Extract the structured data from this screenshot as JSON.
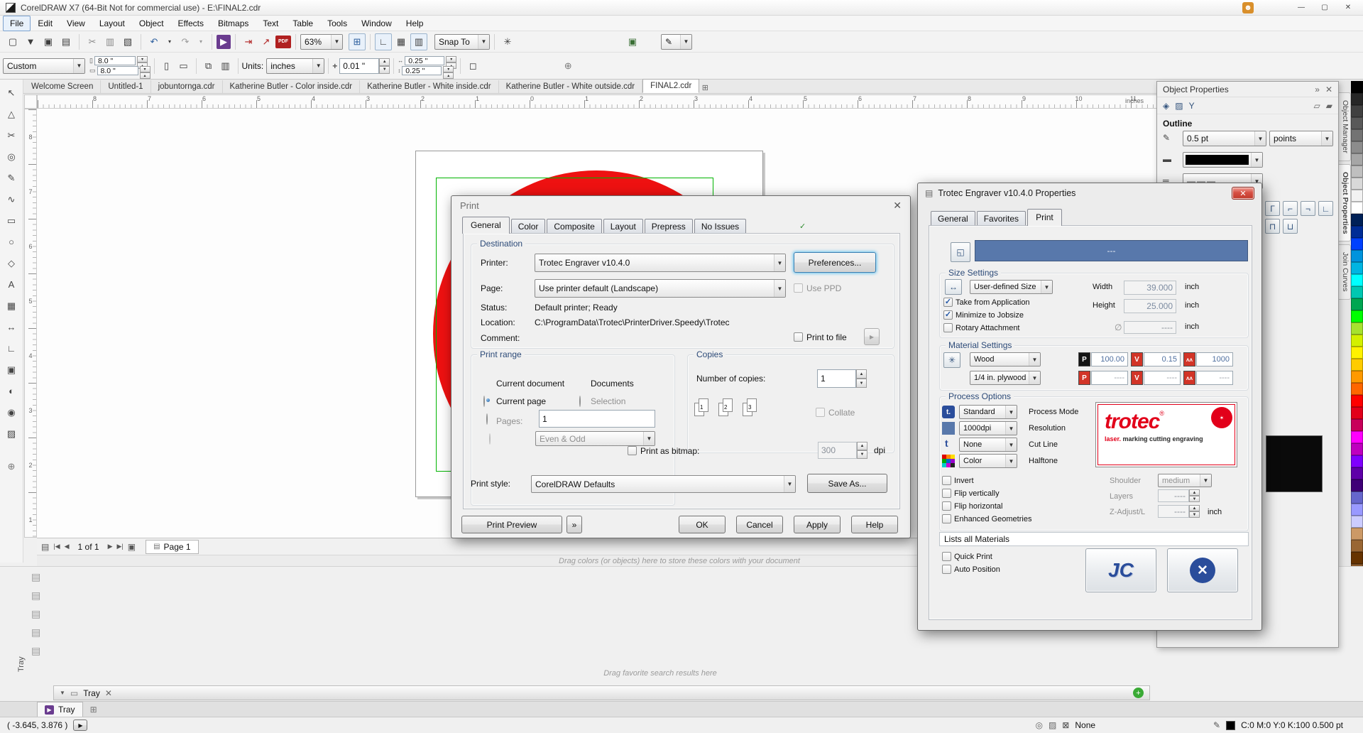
{
  "win": {
    "title": "CorelDRAW X7 (64-Bit Not for commercial use) - E:\\FINAL2.cdr"
  },
  "menu": [
    {
      "label": "File",
      "focus": true
    },
    {
      "label": "Edit"
    },
    {
      "label": "View"
    },
    {
      "label": "Layout"
    },
    {
      "label": "Object"
    },
    {
      "label": "Effects"
    },
    {
      "label": "Bitmaps"
    },
    {
      "label": "Text"
    },
    {
      "label": "Table"
    },
    {
      "label": "Tools"
    },
    {
      "label": "Window"
    },
    {
      "label": "Help"
    }
  ],
  "tb": {
    "zoom": "63%",
    "snap": "Snap To"
  },
  "pb": {
    "preset": "Custom",
    "w": "8.0 \"",
    "h": "8.0 \"",
    "units_l": "Units:",
    "units": "inches",
    "nudge": "0.01 \"",
    "dx": "0.25 \"",
    "dy": "0.25 \""
  },
  "tabs": [
    {
      "label": "Welcome Screen"
    },
    {
      "label": "Untitled-1"
    },
    {
      "label": "jobuntornga.cdr"
    },
    {
      "label": "Katherine Butler - Color inside.cdr"
    },
    {
      "label": "Katherine Butler - White inside.cdr"
    },
    {
      "label": "Katherine Butler - White outside.cdr"
    },
    {
      "label": "FINAL2.cdr",
      "active": true
    }
  ],
  "rul": {
    "h": [
      "8",
      "7",
      "6",
      "5",
      "4",
      "3",
      "2",
      "1",
      "0",
      "1",
      "2",
      "3",
      "4",
      "5",
      "6",
      "7",
      "8",
      "9",
      "10",
      "11"
    ],
    "v": [
      "8",
      "7",
      "6",
      "5",
      "4",
      "3",
      "2",
      "1"
    ],
    "unit": "inches"
  },
  "tools": [
    {
      "name": "pick-tool-icon",
      "g": "↖"
    },
    {
      "name": "shape-tool-icon",
      "g": "△"
    },
    {
      "name": "crop-tool-icon",
      "g": "✂"
    },
    {
      "name": "zoom-tool-icon",
      "g": "◎"
    },
    {
      "name": "freehand-tool-icon",
      "g": "✎"
    },
    {
      "name": "artistic-media-tool-icon",
      "g": "∿"
    },
    {
      "name": "rectangle-tool-icon",
      "g": "▭"
    },
    {
      "name": "ellipse-tool-icon",
      "g": "○"
    },
    {
      "name": "polygon-tool-icon",
      "g": "◇"
    },
    {
      "name": "text-tool-icon",
      "g": "A"
    },
    {
      "name": "table-tool-icon",
      "g": "▦"
    },
    {
      "name": "dimension-tool-icon",
      "g": "↔"
    },
    {
      "name": "connector-tool-icon",
      "g": "∟"
    },
    {
      "name": "drop-shadow-tool-icon",
      "g": "▣"
    },
    {
      "name": "transparency-tool-icon",
      "g": "◐"
    },
    {
      "name": "eyedropper-tool-icon",
      "g": "◉"
    },
    {
      "name": "interactive-fill-tool-icon",
      "g": "▨"
    }
  ],
  "pd": {
    "title": "Print",
    "tabs": [
      {
        "l": "General",
        "active": true
      },
      {
        "l": "Color"
      },
      {
        "l": "Composite"
      },
      {
        "l": "Layout"
      },
      {
        "l": "Prepress"
      },
      {
        "l": "No Issues",
        "icon": true
      }
    ],
    "dest": {
      "leg": "Destination",
      "printer_l": "Printer:",
      "printer": "Trotec Engraver v10.4.0",
      "prefs": "Preferences...",
      "page_l": "Page:",
      "page": "Use printer default (Landscape)",
      "ppd": "Use PPD",
      "status_l": "Status:",
      "status": "Default printer; Ready",
      "loc_l": "Location:",
      "loc": "C:\\ProgramData\\Trotec\\PrinterDriver.Speedy\\Trotec",
      "com_l": "Comment:",
      "ptf": "Print to file"
    },
    "rng": {
      "leg": "Print range",
      "cd": "Current document",
      "docs": "Documents",
      "cp": "Current page",
      "sel": "Selection",
      "pages_l": "Pages:",
      "pages": "1",
      "eo": "Even & Odd"
    },
    "cop": {
      "leg": "Copies",
      "n_l": "Number of copies:",
      "n": "1",
      "collate": "Collate",
      "pgs": [
        "1",
        "2",
        "3"
      ]
    },
    "bmp": {
      "l": "Print as bitmap:",
      "v": "300",
      "u": "dpi"
    },
    "sty": {
      "l": "Print style:",
      "v": "CorelDRAW Defaults",
      "save": "Save As..."
    },
    "btn": {
      "prev": "Print Preview",
      "ok": "OK",
      "cancel": "Cancel",
      "apply": "Apply",
      "help": "Help"
    }
  },
  "td": {
    "title": "Trotec Engraver v10.4.0 Properties",
    "tabs": [
      {
        "l": "General"
      },
      {
        "l": "Favorites"
      },
      {
        "l": "Print",
        "active": true
      }
    ],
    "bar": "---",
    "size": {
      "leg": "Size Settings",
      "preset": "User-defined Size",
      "w_l": "Width",
      "w": "39.000",
      "h_l": "Height",
      "h": "25.000",
      "u": "inch",
      "c1": "Take from Application",
      "c2": "Minimize to Jobsize",
      "c3": "Rotary Attachment",
      "dia": "∅",
      "dia_v": "----"
    },
    "mat": {
      "leg": "Material Settings",
      "grp": "Wood",
      "typ": "1/4 in. plywood",
      "p": "P",
      "v": "V",
      "p1": "100.00",
      "v1": "0.15",
      "f1": "1000",
      "p2": "----",
      "v2": "----",
      "f2": "----"
    },
    "proc": {
      "leg": "Process Options",
      "mode": "Standard",
      "mode_l": "Process Mode",
      "res": "1000dpi",
      "res_l": "Resolution",
      "cut": "None",
      "cut_l": "Cut Line",
      "half": "Color",
      "half_l": "Halftone",
      "c1": "Invert",
      "c2": "Flip vertically",
      "c3": "Flip horizontal",
      "c4": "Enhanced Geometries",
      "sh_l": "Shoulder",
      "sh": "medium",
      "lay_l": "Layers",
      "lay": "----",
      "z_l": "Z-Adjust/L",
      "z": "----",
      "z_u": "inch"
    },
    "logo": {
      "brand": "trotec",
      "reg": "®",
      "tag_a": "laser.",
      "tag_b": "marking cutting engraving"
    },
    "hint": "Lists all Materials",
    "quick": "Quick Print",
    "auto": "Auto Position",
    "jc": "JC"
  },
  "dk": {
    "title": "Object Properties",
    "sec": "Outline",
    "w": "0.5 pt",
    "units": "points",
    "stabs": [
      {
        "label": "Object Manager"
      },
      {
        "label": "Object Properties",
        "active": true
      },
      {
        "label": "Join Curves"
      }
    ]
  },
  "pal": [
    "#000000",
    "#262626",
    "#404040",
    "#595959",
    "#737373",
    "#8c8c8c",
    "#a6a6a6",
    "#bfbfbf",
    "#d9d9d9",
    "#f2f2f2",
    "#ffffff",
    "#002157",
    "#002d96",
    "#0040ff",
    "#0093dd",
    "#00b5e2",
    "#00ffff",
    "#00c7b1",
    "#00a651",
    "#00ff00",
    "#a6e22e",
    "#d3f000",
    "#fff200",
    "#ffcc00",
    "#ff9900",
    "#ff6600",
    "#ff0000",
    "#e2001a",
    "#c8005a",
    "#ff00ff",
    "#bf00bf",
    "#7f00ff",
    "#5f00a8",
    "#3f0077",
    "#6666cc",
    "#9999ff",
    "#ccccff",
    "#cc9966",
    "#996633",
    "#663300",
    "#8b5a2b",
    "#d2b48c",
    "#e8c9a0",
    "#f0e0c0",
    "#d0d0d0",
    "#9e9e9e"
  ],
  "bt": {
    "nav": "1 of 1",
    "ptab": "Page 1",
    "chint": "Drag colors (or objects) here to store these colors with your document",
    "fhint": "Drag favorite search results here",
    "tray": "Tray"
  },
  "st": {
    "xy": "( -3.645, 3.876 )",
    "none": "None",
    "out": "C:0 M:0 Y:0 K:100  0.500 pt"
  },
  "colors": {
    "trotec_red": "#e2001a",
    "bar_blue": "#5878ab",
    "chip_red": "#d23427",
    "chip_black": "#141414",
    "object_green": "#00b400",
    "shape_red": "#ee1111"
  }
}
